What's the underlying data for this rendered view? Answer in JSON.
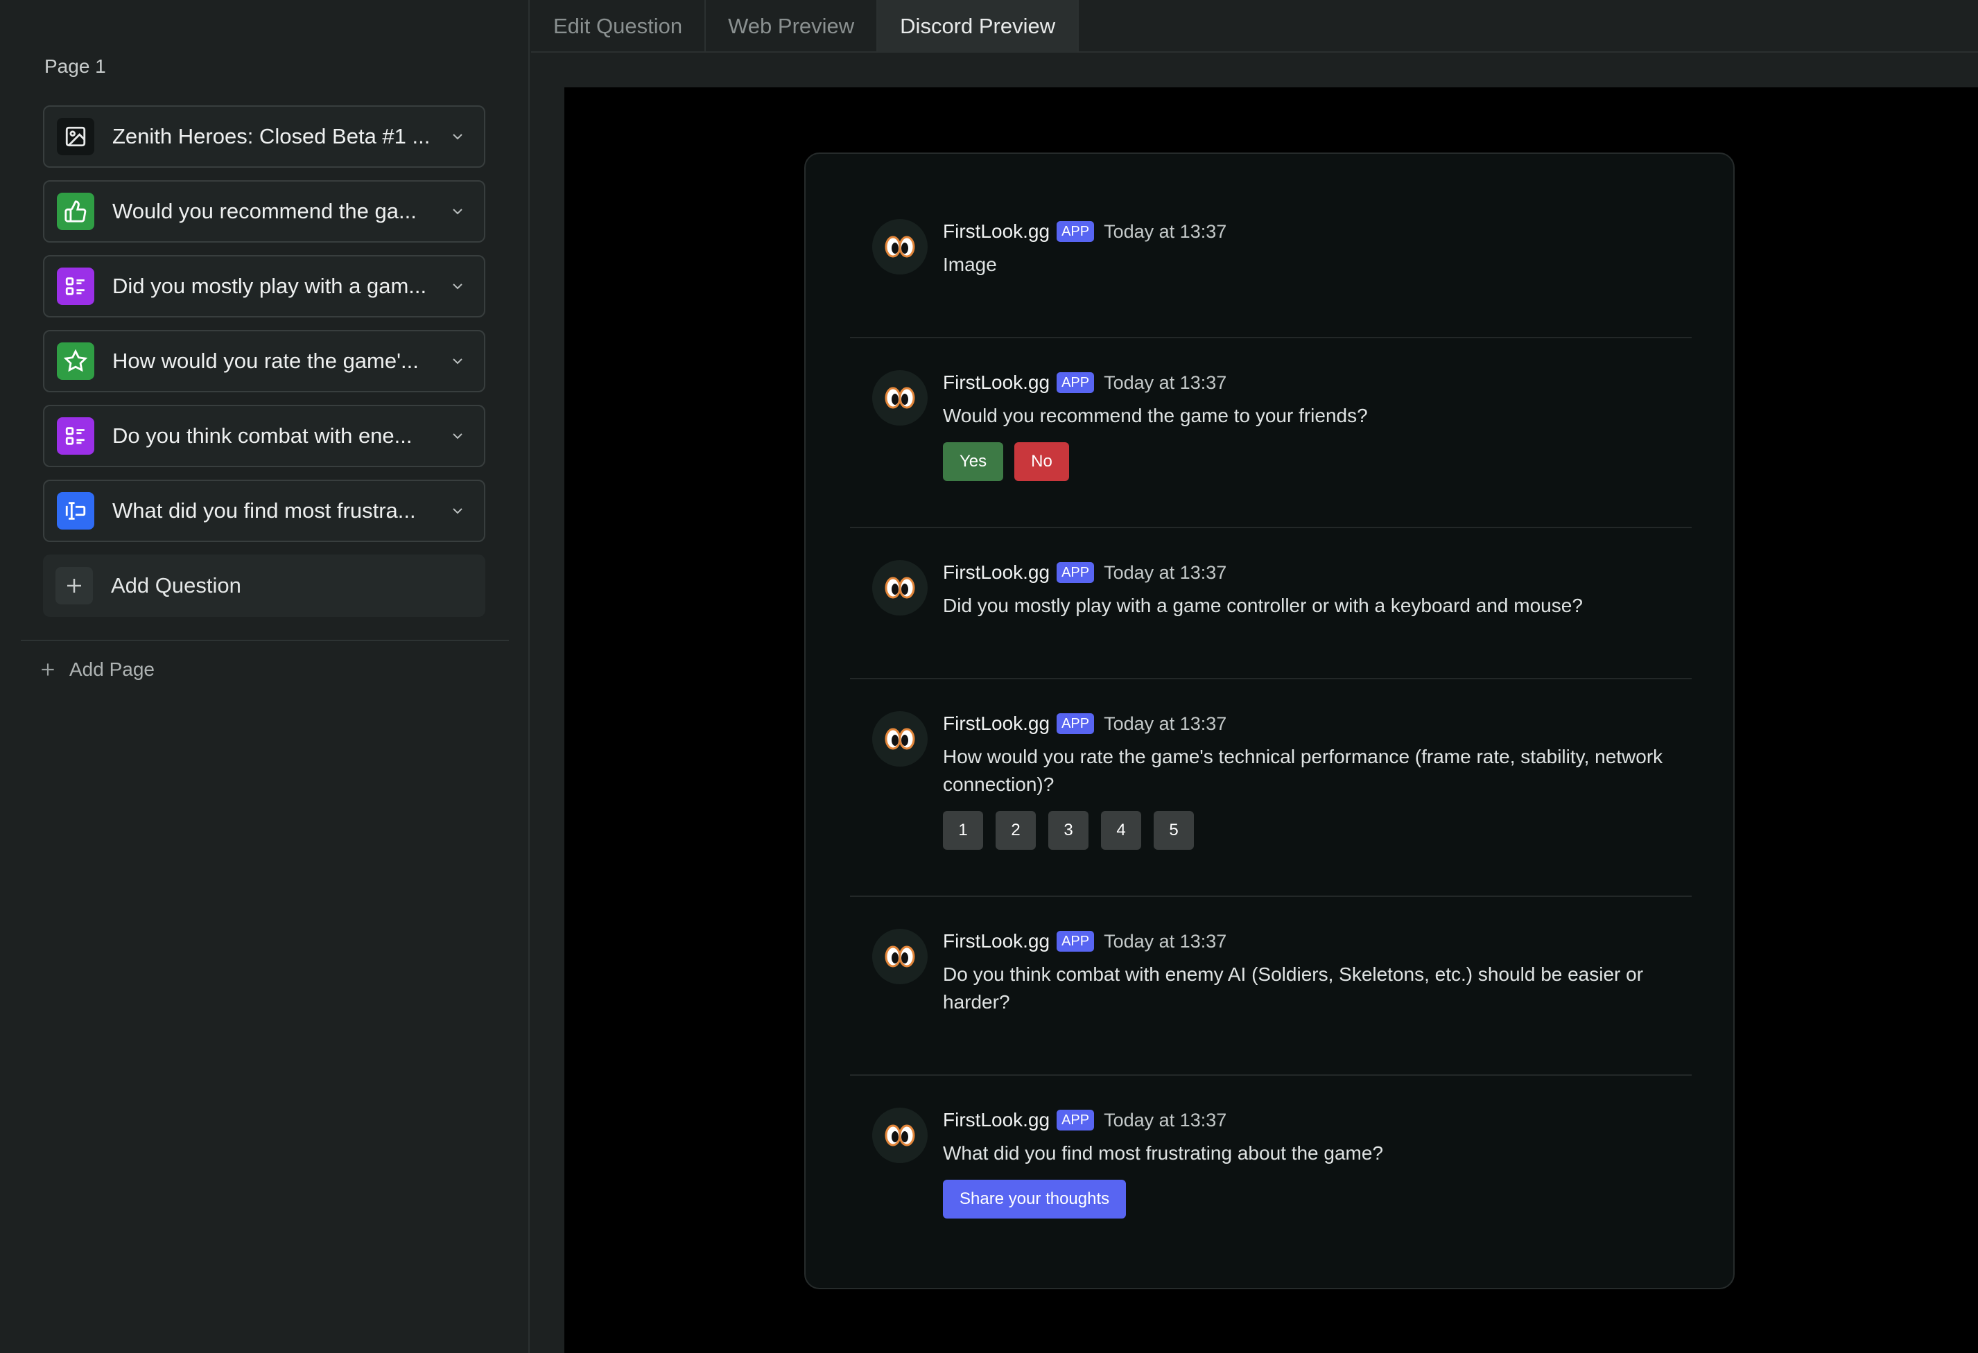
{
  "sidebar": {
    "page_label": "Page 1",
    "questions": [
      {
        "label": "Zenith Heroes: Closed Beta #1 ...",
        "icon": "image-icon",
        "color": "#111515"
      },
      {
        "label": "Would you recommend the ga...",
        "icon": "thumbs-up-icon",
        "color": "#2f9e44"
      },
      {
        "label": "Did you mostly play with a gam...",
        "icon": "list-icon",
        "color": "#9b30e8"
      },
      {
        "label": "How would you rate the game'...",
        "icon": "star-icon",
        "color": "#2f9e44"
      },
      {
        "label": "Do you think combat with ene...",
        "icon": "list-icon",
        "color": "#9b30e8"
      },
      {
        "label": "What did you find most frustra...",
        "icon": "text-input-icon",
        "color": "#2f6cf5"
      }
    ],
    "add_question_label": "Add Question",
    "add_page_label": "Add Page"
  },
  "tabs": [
    {
      "label": "Edit Question",
      "active": false
    },
    {
      "label": "Web Preview",
      "active": false
    },
    {
      "label": "Discord Preview",
      "active": true
    }
  ],
  "discord": {
    "messages": [
      {
        "author": "FirstLook.gg",
        "badge": "APP",
        "time": "Today at 13:37",
        "text": "Image"
      },
      {
        "author": "FirstLook.gg",
        "badge": "APP",
        "time": "Today at 13:37",
        "text": "Would you recommend the game to your friends?",
        "buttons": [
          "Yes",
          "No"
        ]
      },
      {
        "author": "FirstLook.gg",
        "badge": "APP",
        "time": "Today at 13:37",
        "text": "Did you mostly play with a game controller or with a keyboard and mouse?"
      },
      {
        "author": "FirstLook.gg",
        "badge": "APP",
        "time": "Today at 13:37",
        "text": "How would you rate the game's technical performance (frame rate, stability, network connection)?",
        "rating": [
          "1",
          "2",
          "3",
          "4",
          "5"
        ]
      },
      {
        "author": "FirstLook.gg",
        "badge": "APP",
        "time": "Today at 13:37",
        "text": "Do you think combat with enemy AI (Soldiers, Skeletons, etc.) should be easier or harder?"
      },
      {
        "author": "FirstLook.gg",
        "badge": "APP",
        "time": "Today at 13:37",
        "text": "What did you find most frustrating about the game?",
        "action": "Share your thoughts"
      }
    ]
  },
  "colors": {
    "accent_blurple": "#5865f2",
    "yes_green": "#3d7a45",
    "no_red": "#c9373c"
  }
}
